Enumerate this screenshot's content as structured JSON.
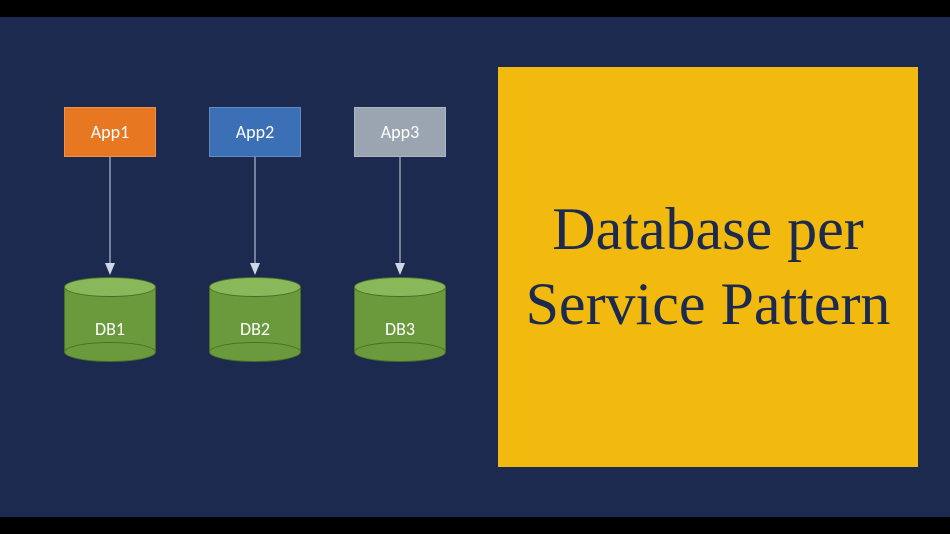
{
  "title": "Database per Service Pattern",
  "services": [
    {
      "app": "App1",
      "db": "DB1",
      "appColorClass": "app-orange"
    },
    {
      "app": "App2",
      "db": "DB2",
      "appColorClass": "app-blue"
    },
    {
      "app": "App3",
      "db": "DB3",
      "appColorClass": "app-gray"
    }
  ],
  "colors": {
    "background": "#1b2a4e",
    "panel": "#f2b90f",
    "app1": "#e87722",
    "app2": "#3b6fb6",
    "app3": "#9aa5b1",
    "db": "#6a9a3b"
  }
}
